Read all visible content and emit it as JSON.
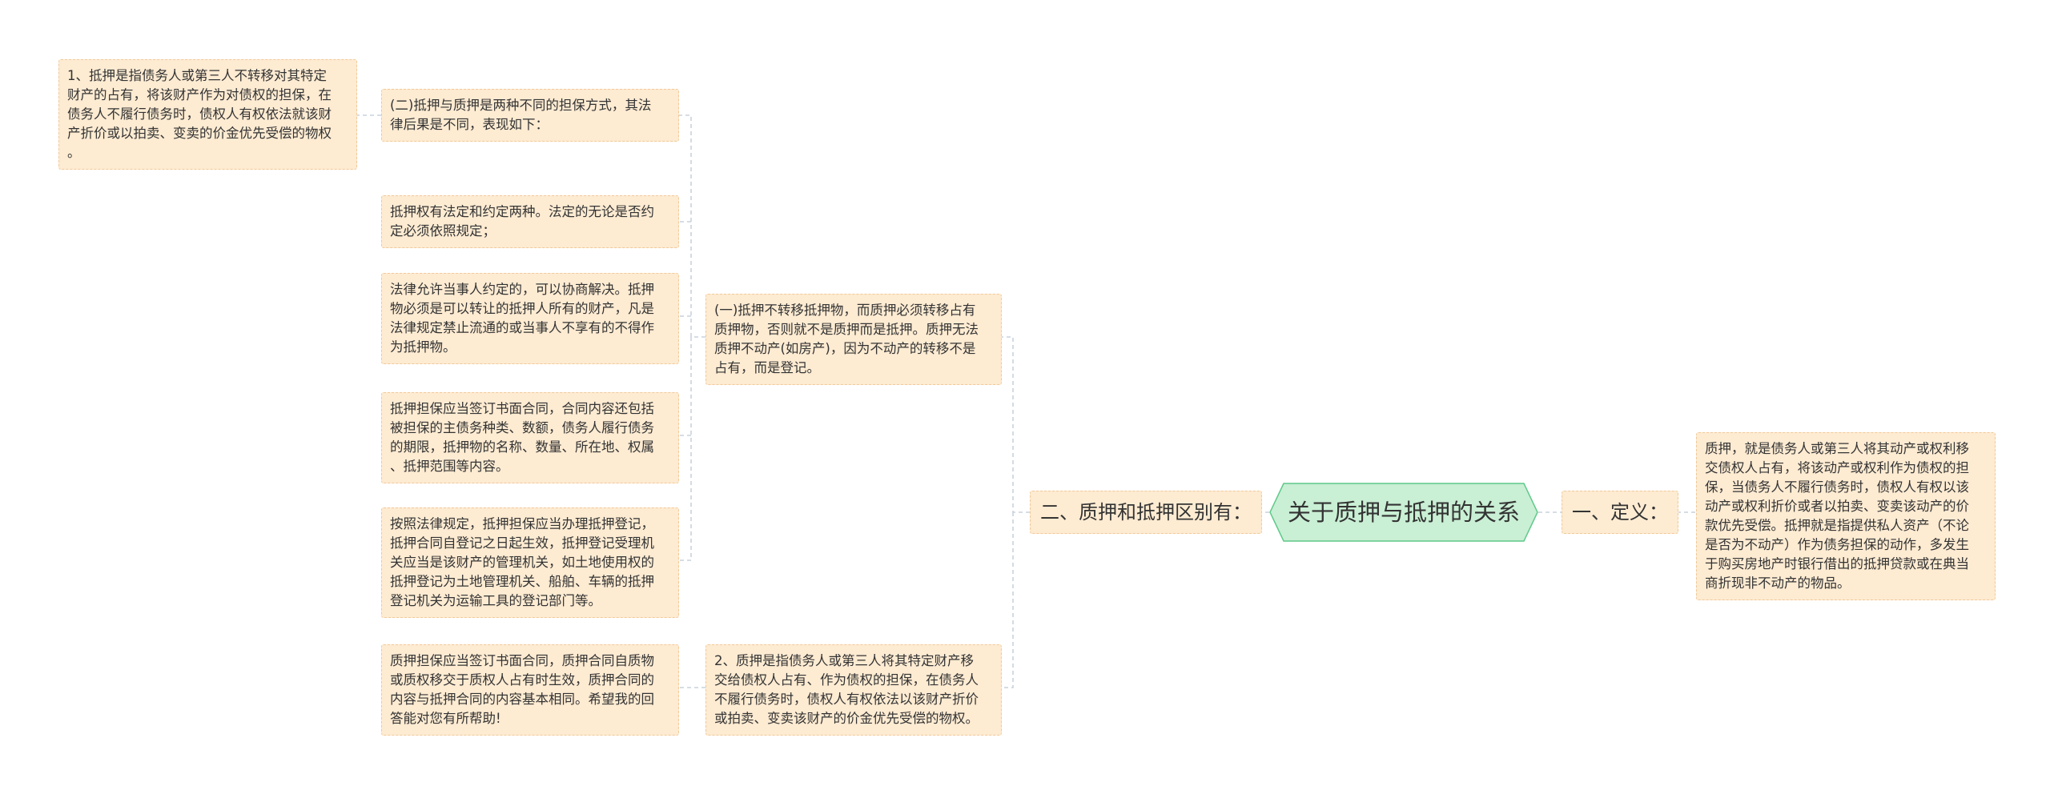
{
  "root": {
    "title": "关于质押与抵押的关系"
  },
  "branches": {
    "difference": "二、质押和抵押区别有：",
    "definition": "一、定义："
  },
  "definition_text": "质押，就是债务人或第三人将其动产或权利移\n交债权人占有，将该动产或权利作为债权的担\n保，当债务人不履行债务时，债权人有权以该\n动产或权利折价或者以拍卖、变卖该动产的价\n款优先受偿。抵押就是指提供私人资产（不论\n是否为不动产）作为债务担保的动作，多发生\n于购买房地产时银行借出的抵押贷款或在典当\n商折现非不动产的物品。",
  "sub_one": "(一)抵押不转移抵押物，而质押必须转移占有\n质押物，否则就不是质押而是抵押。质押无法\n质押不动产(如房产)，因为不动产的转移不是\n占有，而是登记。",
  "sub_two": "2、质押是指债务人或第三人将其特定财产移\n交给债权人占有、作为债权的担保，在债务人\n不履行债务时，债权人有权依法以该财产折价\n或拍卖、变卖该财产的价金优先受偿的物权。",
  "leaves": {
    "l1": "(二)抵押与质押是两种不同的担保方式，其法\n律后果是不同，表现如下：",
    "l2": "抵押权有法定和约定两种。法定的无论是否约\n定必须依照规定；",
    "l3": "法律允许当事人约定的，可以协商解决。抵押\n物必须是可以转让的抵押人所有的财产，凡是\n法律规定禁止流通的或当事人不享有的不得作\n为抵押物。",
    "l4": "抵押担保应当签订书面合同，合同内容还包括\n被担保的主债务种类、数额，债务人履行债务\n的期限，抵押物的名称、数量、所在地、权属\n、抵押范围等内容。",
    "l5": "按照法律规定，抵押担保应当办理抵押登记，\n抵押合同自登记之日起生效，抵押登记受理机\n关应当是该财产的管理机关，如土地使用权的\n抵押登记为土地管理机关、船舶、车辆的抵押\n登记机关为运输工具的登记部门等。",
    "l6": "质押担保应当签订书面合同，质押合同自质物\n或质权移交于质权人占有时生效，质押合同的\n内容与抵押合同的内容基本相同。希望我的回\n答能对您有所帮助!",
    "far": "1、抵押是指债务人或第三人不转移对其特定\n财产的占有，将该财产作为对债权的担保，在\n债务人不履行债务时，债权人有权依法就该财\n产折价或以拍卖、变卖的价金优先受偿的物权\n。"
  },
  "colors": {
    "root_fill": "#c9efd4",
    "root_stroke": "#5fc98a",
    "box_fill": "#fdebd2",
    "box_border": "#f2c99a",
    "connector": "#c8d2dc",
    "text": "#333333"
  }
}
